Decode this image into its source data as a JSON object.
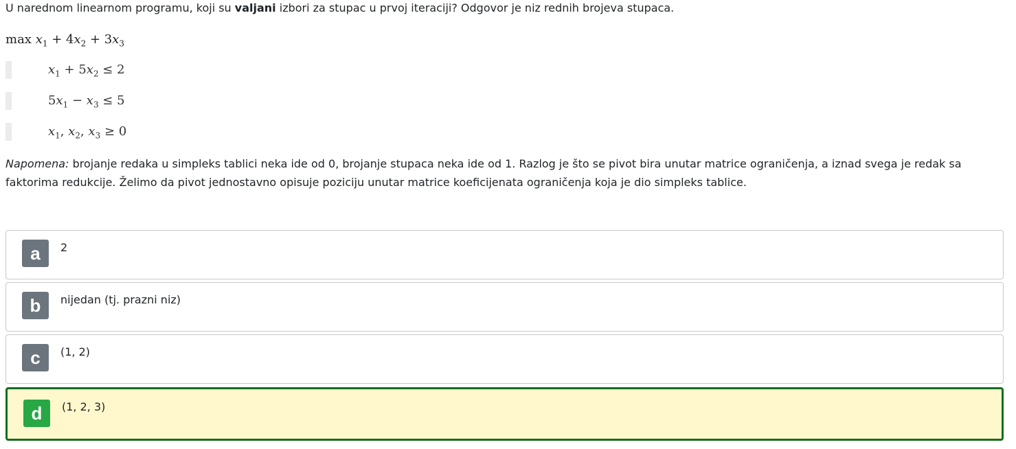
{
  "question": {
    "text_before": "U narednom linearnom programu, koji su ",
    "text_bold": "valjani",
    "text_after": " izbori za stupac u prvoj iteraciji? Odgovor je niz rednih brojeva stupaca."
  },
  "problem": {
    "objective": {
      "max": "max",
      "x": "x",
      "s1": "1",
      "plus1": " + 4",
      "s2": "2",
      "plus2": " + 3",
      "s3": "3"
    },
    "constraints": [
      {
        "x": "x",
        "a1": "1",
        "mid": " + 5",
        "a2": "2",
        "rel": " ≤ 2"
      },
      {
        "coef": "5",
        "x": "x",
        "a1": "1",
        "mid": " − ",
        "a2": "3",
        "rel": " ≤ 5"
      },
      {
        "x": "x",
        "a1": "1",
        "c1": ", ",
        "a2": "2",
        "c2": ", ",
        "a3": "3",
        "rel": " ≥ 0"
      }
    ]
  },
  "note": {
    "label": "Napomena:",
    "text": " brojanje redaka u simpleks tablici neka ide od 0, brojanje stupaca neka ide od 1. Razlog je što se pivot bira unutar matrice ograničenja, a iznad svega je redak sa faktorima redukcije. Želimo da pivot jednostavno opisuje poziciju unutar matrice koeficijenata ograničenja koja je dio simpleks tablice."
  },
  "answers": [
    {
      "letter": "a",
      "text": "2",
      "selected": false
    },
    {
      "letter": "b",
      "text": "nijedan (tj. prazni niz)",
      "selected": false
    },
    {
      "letter": "c",
      "text": "(1, 2)",
      "selected": false
    },
    {
      "letter": "d",
      "text": "(1, 2, 3)",
      "selected": true
    }
  ],
  "colors": {
    "badge_default": "#6c757d",
    "badge_selected": "#28a745",
    "selected_background": "#fff8cc",
    "selected_border": "#146c1f"
  }
}
